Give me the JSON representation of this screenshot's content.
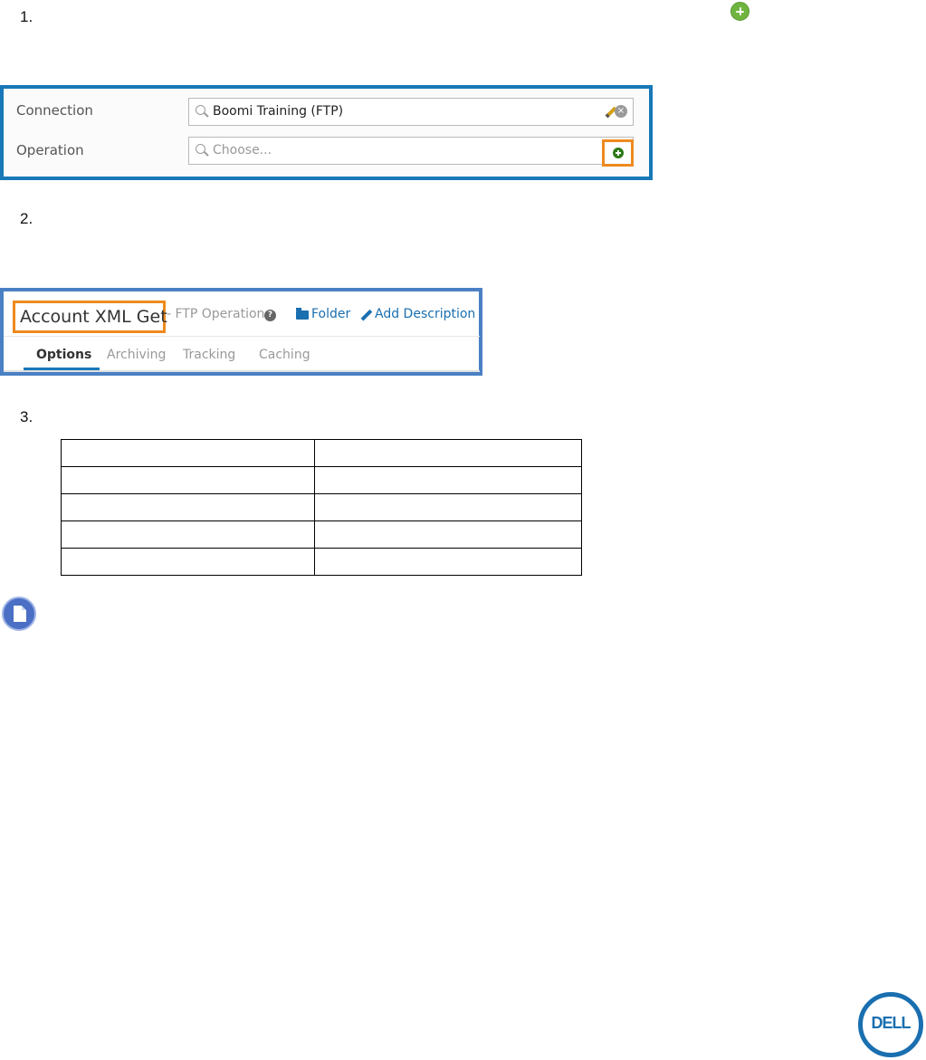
{
  "steps": {
    "s1": "1.",
    "s2": "2.",
    "s3": "3."
  },
  "connection_panel": {
    "connection_label": "Connection",
    "connection_value": "Boomi Training (FTP)",
    "operation_label": "Operation",
    "operation_placeholder": "Choose..."
  },
  "operation_header": {
    "name": "Account XML Get",
    "type": "- FTP Operation",
    "folder_link": "Folder",
    "description_link": "Add Description",
    "tabs": [
      "Options",
      "Archiving",
      "Tracking",
      "Caching"
    ],
    "active_tab": "Options"
  },
  "table": {
    "rows": [
      [
        "",
        ""
      ],
      [
        "",
        ""
      ],
      [
        "",
        ""
      ],
      [
        "",
        ""
      ],
      [
        "",
        ""
      ]
    ]
  },
  "logo": {
    "text": "DELL"
  },
  "colors": {
    "panel_border": "#1878b8",
    "highlight": "#ee8a1e",
    "link": "#1a6fb0",
    "green_icon": "#6fb43f"
  }
}
